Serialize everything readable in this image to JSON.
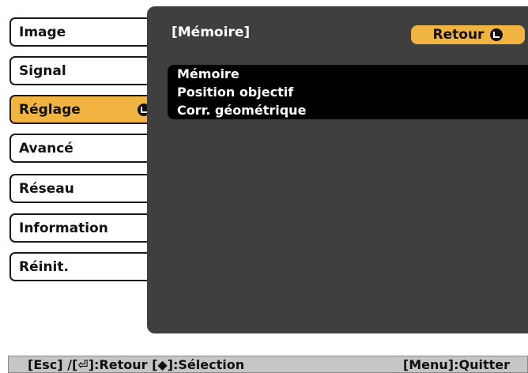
{
  "menu": {
    "items": [
      {
        "label": "Image"
      },
      {
        "label": "Signal"
      },
      {
        "label": "Réglage"
      },
      {
        "label": "Avancé"
      },
      {
        "label": "Réseau"
      },
      {
        "label": "Information"
      },
      {
        "label": "Réinit."
      }
    ],
    "selected_index": 2
  },
  "panel": {
    "title": "[Mémoire]",
    "back_label": "Retour",
    "items": [
      {
        "label": "Mémoire"
      },
      {
        "label": "Position objectif"
      },
      {
        "label": "Corr. géométrique"
      }
    ]
  },
  "help": {
    "left": "[Esc] /[⏎]:Retour   [◆]:Sélection",
    "right": "[Menu]:Quitter"
  },
  "colors": {
    "accent": "#f2b441",
    "panel_bg": "#3f3f3f",
    "list_bg": "#000000",
    "help_bg": "#c6c6c6"
  },
  "icons": [
    "enter-icon",
    "updown-icon"
  ]
}
